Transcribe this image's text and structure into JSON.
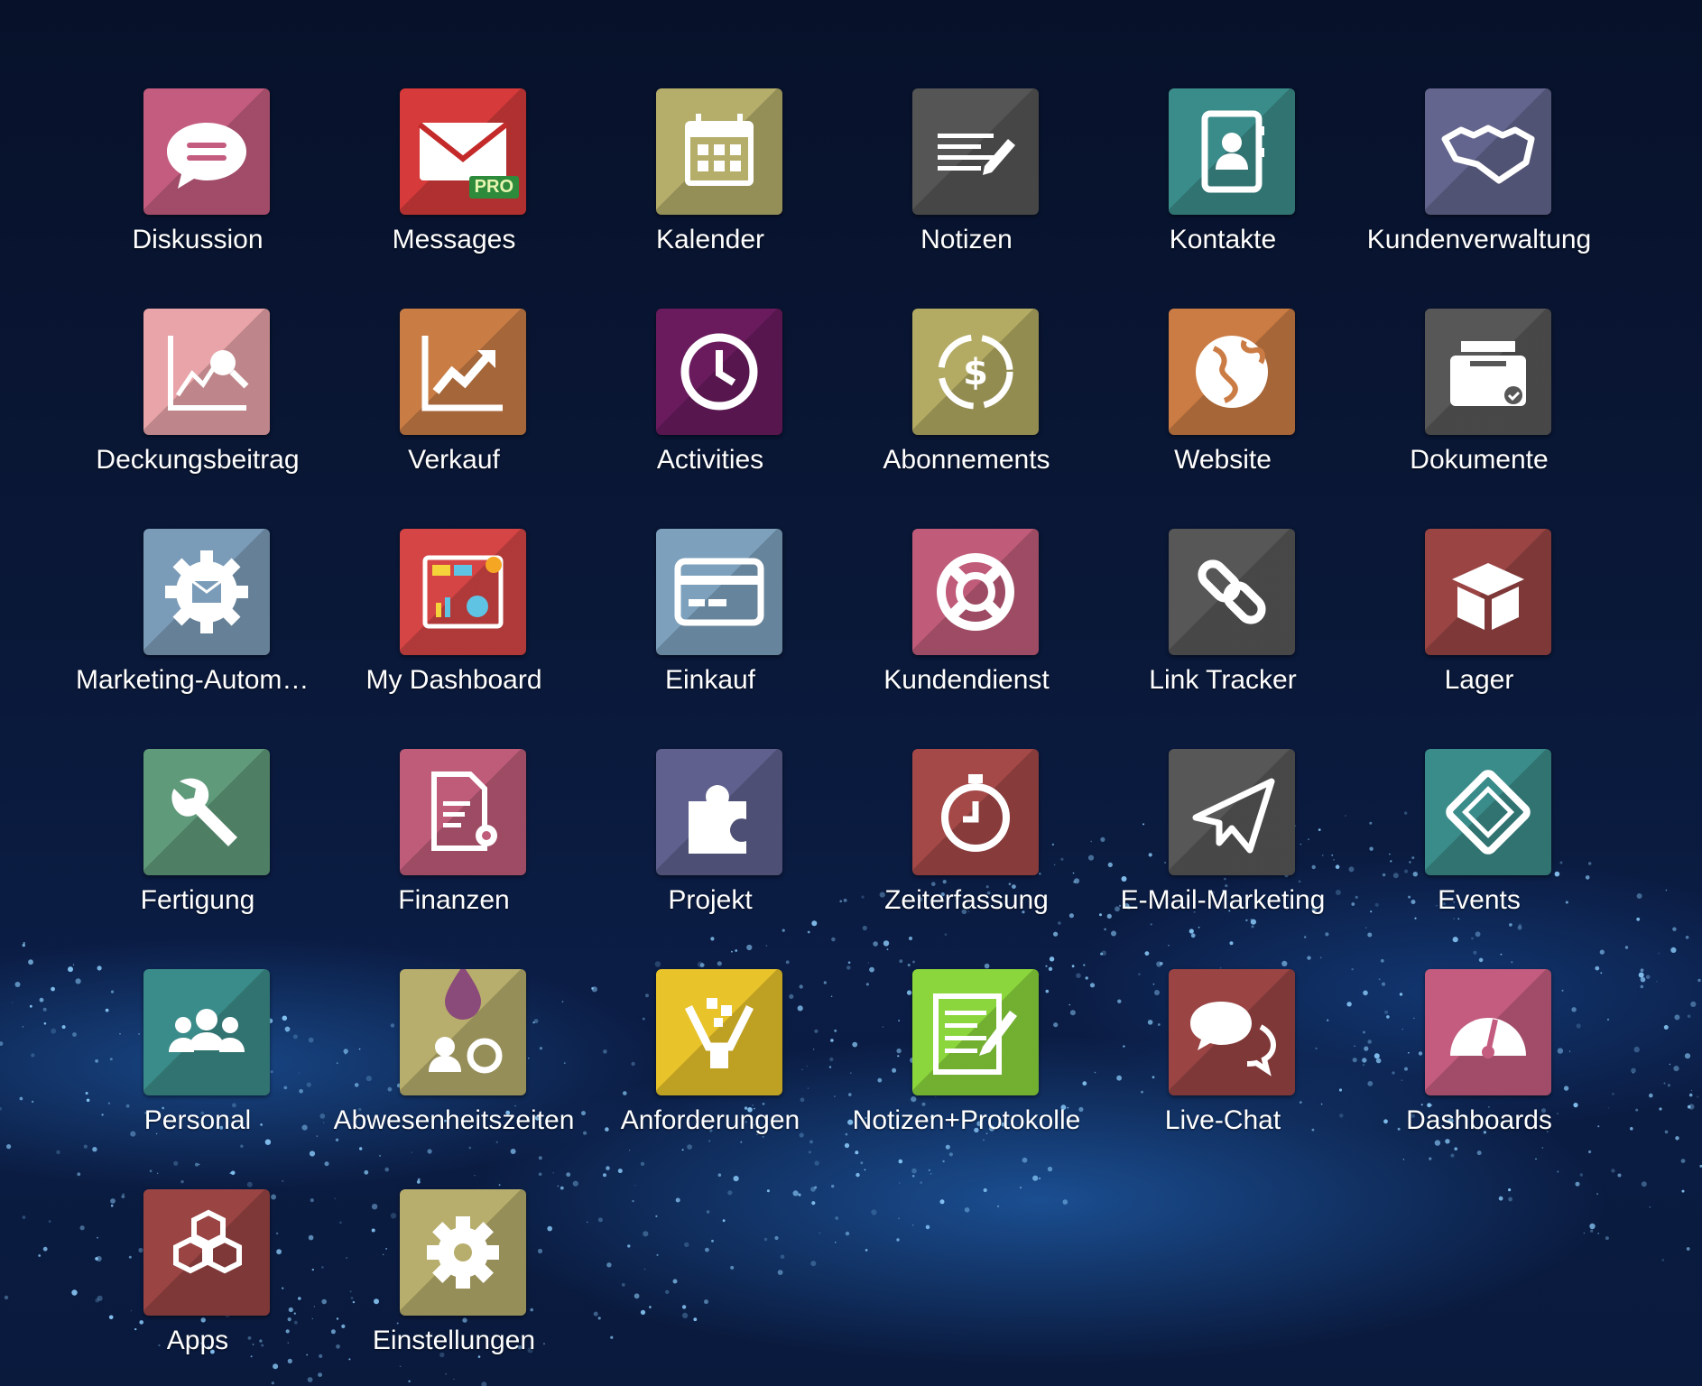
{
  "apps": [
    {
      "label": "Diskussion",
      "color": "#c45c7f",
      "icon": "chat-bubble-icon"
    },
    {
      "label": "Messages",
      "color": "#d63a3a",
      "icon": "envelope-icon",
      "badge": "PRO"
    },
    {
      "label": "Kalender",
      "color": "#b5ad6a",
      "icon": "calendar-icon"
    },
    {
      "label": "Notizen",
      "color": "#555555",
      "icon": "note-pencil-icon"
    },
    {
      "label": "Kontakte",
      "color": "#3a8c8a",
      "icon": "address-book-icon"
    },
    {
      "label": "Kundenverwaltung",
      "color": "#63658e",
      "icon": "handshake-icon"
    },
    {
      "label": "Deckungsbeitrag",
      "color": "#e8a4a8",
      "icon": "chart-analysis-icon"
    },
    {
      "label": "Verkauf",
      "color": "#c97d45",
      "icon": "trend-chart-icon"
    },
    {
      "label": "Activities",
      "color": "#6a1b5e",
      "icon": "clock-icon"
    },
    {
      "label": "Abonnements",
      "color": "#b3ab63",
      "icon": "dollar-cycle-icon"
    },
    {
      "label": "Website",
      "color": "#cb7c44",
      "icon": "globe-icon"
    },
    {
      "label": "Dokumente",
      "color": "#575757",
      "icon": "document-tray-icon"
    },
    {
      "label": "Marketing-Automat...",
      "color": "#7b9cb8",
      "icon": "gear-envelope-icon"
    },
    {
      "label": "My Dashboard",
      "color": "#d64545",
      "icon": "dashboard-report-icon"
    },
    {
      "label": "Einkauf",
      "color": "#7da1bd",
      "icon": "credit-card-icon"
    },
    {
      "label": "Kundendienst",
      "color": "#c05c7a",
      "icon": "lifebuoy-icon"
    },
    {
      "label": "Link Tracker",
      "color": "#575757",
      "icon": "link-icon"
    },
    {
      "label": "Lager",
      "color": "#9b4444",
      "icon": "box-icon"
    },
    {
      "label": "Fertigung",
      "color": "#5f9a7a",
      "icon": "wrench-icon"
    },
    {
      "label": "Finanzen",
      "color": "#bf5c7a",
      "icon": "document-gear-icon"
    },
    {
      "label": "Projekt",
      "color": "#5f608d",
      "icon": "puzzle-icon"
    },
    {
      "label": "Zeiterfassung",
      "color": "#a54848",
      "icon": "stopwatch-icon"
    },
    {
      "label": "E-Mail-Marketing",
      "color": "#575757",
      "icon": "paper-plane-icon"
    },
    {
      "label": "Events",
      "color": "#3a8c8a",
      "icon": "ticket-icon"
    },
    {
      "label": "Personal",
      "color": "#3a8c8a",
      "icon": "people-icon"
    },
    {
      "label": "Abwesenheitszeiten",
      "color": "#b7ad6c",
      "icon": "person-gear-drop-icon"
    },
    {
      "label": "Anforderungen",
      "color": "#e8c32a",
      "icon": "basket-cubes-icon"
    },
    {
      "label": "Notizen+Protokolle",
      "color": "#8bd63c",
      "icon": "note-writing-icon"
    },
    {
      "label": "Live-Chat",
      "color": "#9b4444",
      "icon": "chat-bubbles-icon"
    },
    {
      "label": "Dashboards",
      "color": "#c45c7f",
      "icon": "gauge-icon"
    },
    {
      "label": "Apps",
      "color": "#9b4444",
      "icon": "cubes-icon"
    },
    {
      "label": "Einstellungen",
      "color": "#b7ad6c",
      "icon": "gear-icon"
    }
  ]
}
